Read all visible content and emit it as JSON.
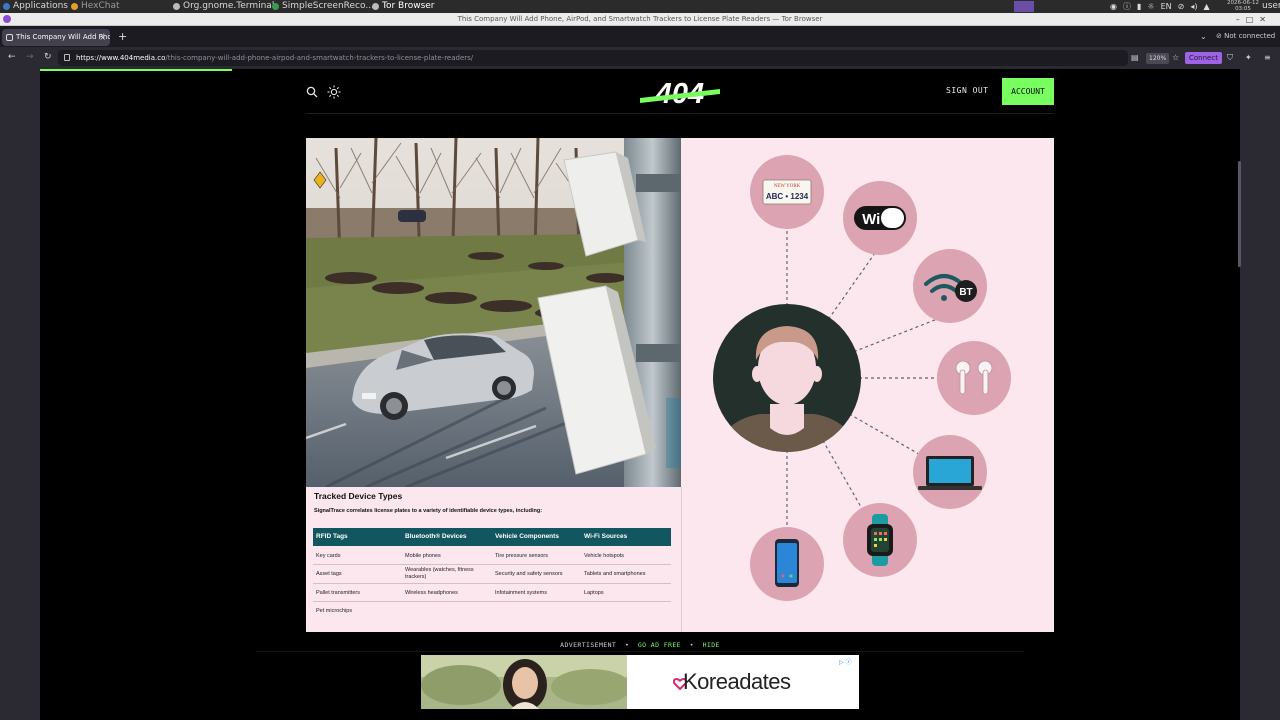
{
  "system": {
    "apps_label": "Applications",
    "tasks": [
      {
        "label": "HexChat",
        "color": "#e0a030"
      },
      {
        "label": "Org.gnome.Terminal",
        "color": "#bbbbbb"
      },
      {
        "label": "SimpleScreenReco...",
        "color": "#3a9a50"
      },
      {
        "label": "Tor Browser",
        "color": "#bbbbbb"
      }
    ],
    "tray_lang": "EN",
    "clock_date": "2026-06-12",
    "clock_time": "03:05",
    "user": "user"
  },
  "window": {
    "title": "This Company Will Add Phone, AirPod, and Smartwatch Trackers to License Plate Readers — Tor Browser"
  },
  "browser": {
    "tab_title": "This Company Will Add Phone",
    "tab_close": "×",
    "new_tab": "+",
    "tabs_menu": "⌄",
    "connection_status": "Not connected",
    "url_host": "https://www.404media.co",
    "url_path": "/this-company-will-add-phone-airpod-and-smartwatch-trackers-to-license-plate-readers/",
    "zoom": "120%",
    "connect_label": "Connect"
  },
  "site": {
    "logo_text": "404",
    "signout_label": "SIGN OUT",
    "account_label": "ACCOUNT",
    "accent": "#79fe61"
  },
  "figure": {
    "heading": "Tracked Device Types",
    "description": "SignalTrace correlates license plates to a variety of identifiable device types, including:",
    "columns": [
      "RFID Tags",
      "Bluetooth® Devices",
      "Vehicle Components",
      "Wi-Fi Sources"
    ],
    "rows": [
      [
        "Key cards",
        "Mobile phones",
        "Tire pressure sensors",
        "Vehicle hotspots"
      ],
      [
        "Asset tags",
        "Wearables (watches, fitness trackers)",
        "Security and safety sensors",
        "Tablets and smartphones"
      ],
      [
        "Pallet transmitters",
        "Wireless headphones",
        "Infotainment systems",
        "Laptops"
      ],
      [
        "Pet microchips",
        "",
        "",
        ""
      ]
    ],
    "plate_state": "NEW YORK",
    "plate_number": "ABC • 1234",
    "wifi_text": "Wi Fi",
    "bt_text": "BT",
    "header_color": "#12575f",
    "node_color": "#dca4b2"
  },
  "ad": {
    "label": "ADVERTISEMENT",
    "go_ad_free": "GO AD FREE",
    "hide": "HIDE",
    "sep": "•",
    "brand": "Koreadates",
    "choice_icon": "ad-choices-icon"
  }
}
